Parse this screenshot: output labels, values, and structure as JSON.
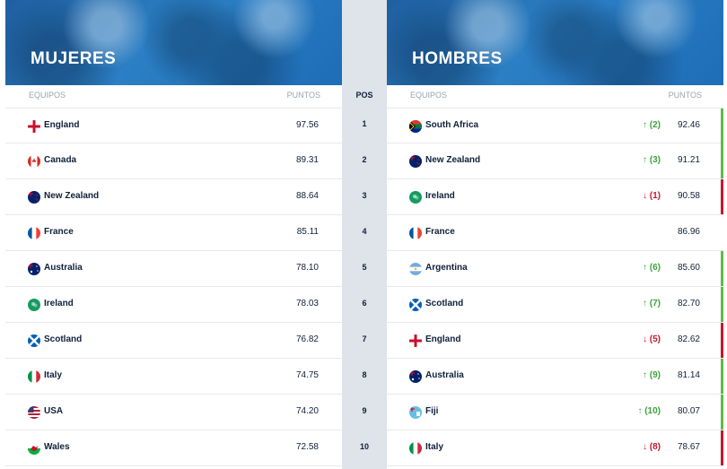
{
  "women": {
    "title": "MUJERES",
    "col_team": "EQUIPOS",
    "col_points": "PUNTOS",
    "rows": [
      {
        "team": "England",
        "points": "97.56",
        "flag": "england-flag"
      },
      {
        "team": "Canada",
        "points": "89.31",
        "flag": "canada-flag"
      },
      {
        "team": "New Zealand",
        "points": "88.64",
        "flag": "new-zealand-flag"
      },
      {
        "team": "France",
        "points": "85.11",
        "flag": "france-flag"
      },
      {
        "team": "Australia",
        "points": "78.10",
        "flag": "australia-flag"
      },
      {
        "team": "Ireland",
        "points": "78.03",
        "flag": "ireland-flag"
      },
      {
        "team": "Scotland",
        "points": "76.82",
        "flag": "scotland-flag"
      },
      {
        "team": "Italy",
        "points": "74.75",
        "flag": "italy-flag"
      },
      {
        "team": "USA",
        "points": "74.20",
        "flag": "usa-flag"
      },
      {
        "team": "Wales",
        "points": "72.58",
        "flag": "wales-flag"
      }
    ]
  },
  "positions": {
    "header": "POS",
    "values": [
      "1",
      "2",
      "3",
      "4",
      "5",
      "6",
      "7",
      "8",
      "9",
      "10"
    ]
  },
  "men": {
    "title": "HOMBRES",
    "col_team": "EQUIPOS",
    "col_points": "PUNTOS",
    "rows": [
      {
        "team": "South Africa",
        "points": "92.46",
        "movement": "↑ (2)",
        "trend": "up",
        "flag": "south-africa-flag"
      },
      {
        "team": "New Zealand",
        "points": "91.21",
        "movement": "↑ (3)",
        "trend": "up",
        "flag": "new-zealand-flag"
      },
      {
        "team": "Ireland",
        "points": "90.58",
        "movement": "↓ (1)",
        "trend": "down",
        "flag": "ireland-flag"
      },
      {
        "team": "France",
        "points": "86.96",
        "movement": "",
        "trend": "none",
        "flag": "france-flag"
      },
      {
        "team": "Argentina",
        "points": "85.60",
        "movement": "↑ (6)",
        "trend": "up",
        "flag": "argentina-flag"
      },
      {
        "team": "Scotland",
        "points": "82.70",
        "movement": "↑ (7)",
        "trend": "up",
        "flag": "scotland-flag"
      },
      {
        "team": "England",
        "points": "82.62",
        "movement": "↓ (5)",
        "trend": "down",
        "flag": "england-flag"
      },
      {
        "team": "Australia",
        "points": "81.14",
        "movement": "↑ (9)",
        "trend": "up",
        "flag": "australia-flag"
      },
      {
        "team": "Fiji",
        "points": "80.07",
        "movement": "↑ (10)",
        "trend": "up",
        "flag": "fiji-flag"
      },
      {
        "team": "Italy",
        "points": "78.67",
        "movement": "↓ (8)",
        "trend": "down",
        "flag": "italy-flag"
      }
    ]
  },
  "colors": {
    "banner": "#2b7fc4",
    "up": "#5dbb46",
    "down": "#c6162c",
    "text": "#10203a",
    "pos_column": "#dfe3ea"
  }
}
